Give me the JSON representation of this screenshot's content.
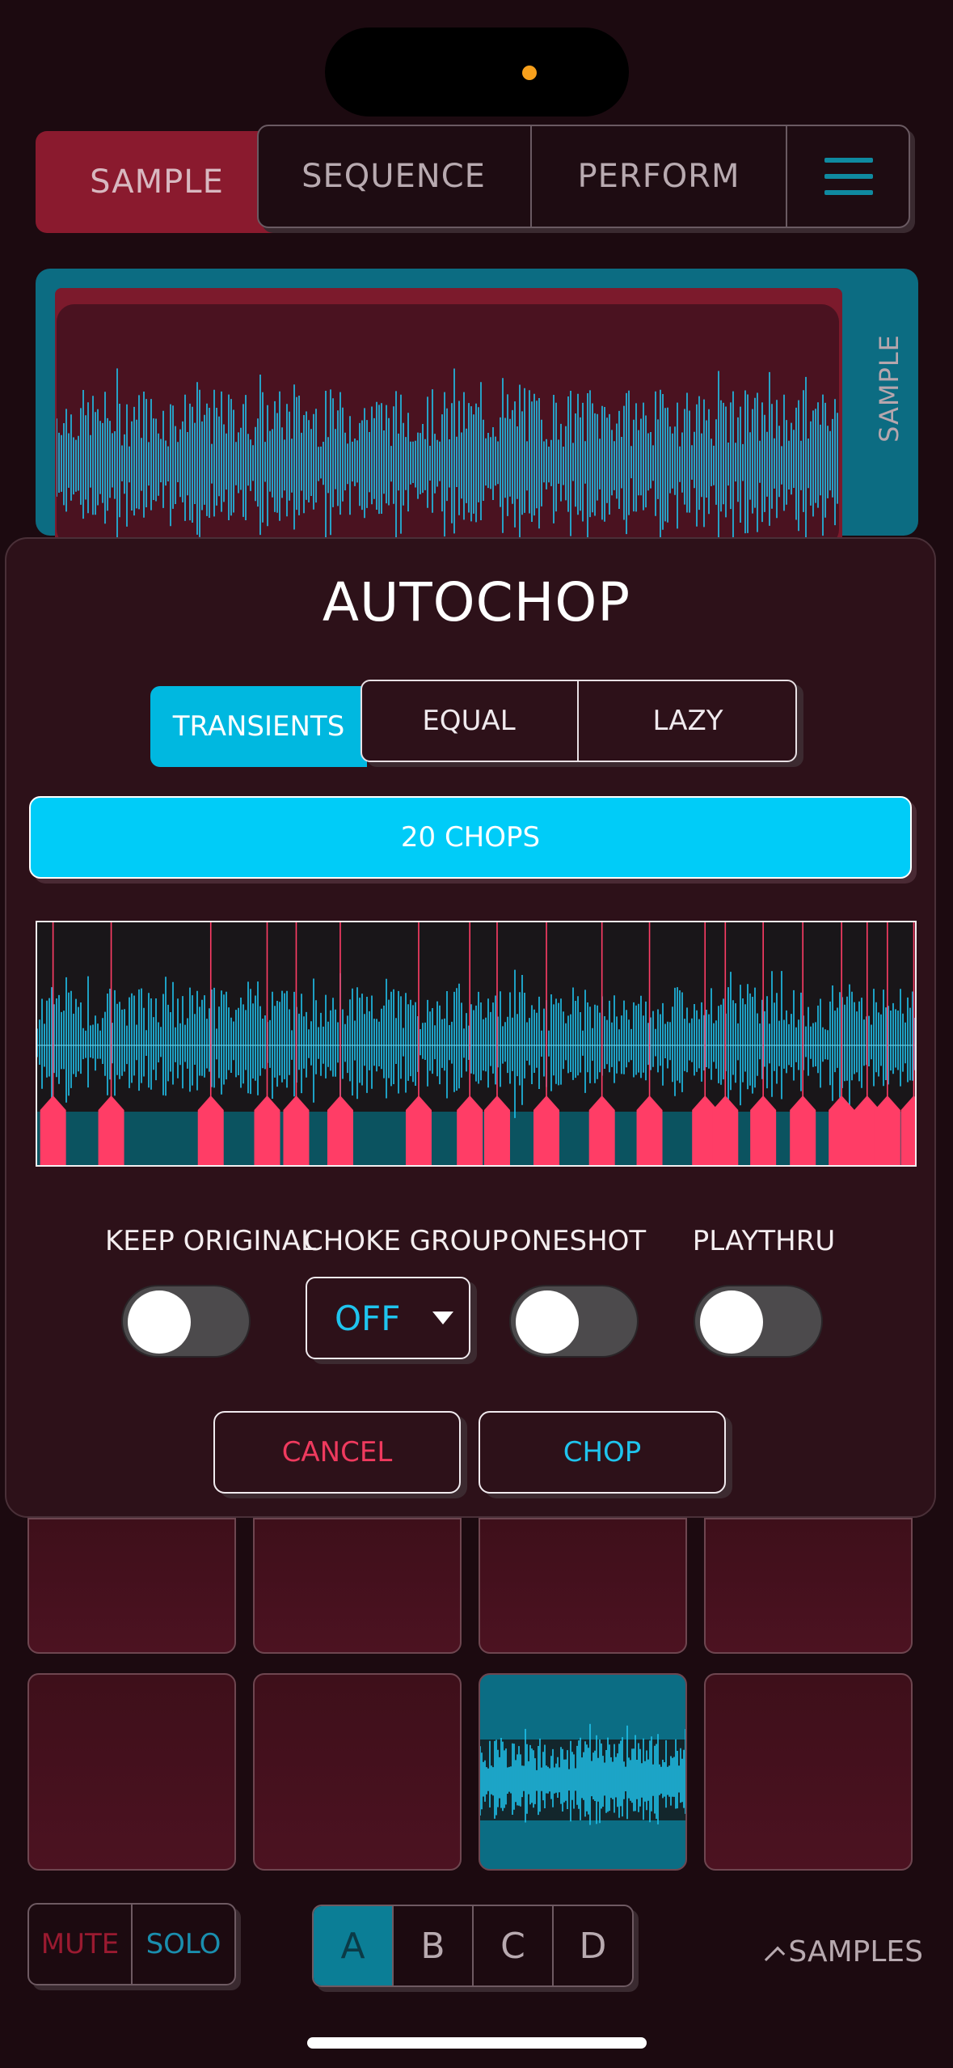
{
  "colors": {
    "accent_cyan": "#00ccf8",
    "waveform": "#1fc4ee",
    "chop_marker": "#ff3d66",
    "cancel_text": "#ef3a5e",
    "background": "#1c0a10",
    "modal_bg": "#2d1119"
  },
  "top_tabs": {
    "sample": "SAMPLE",
    "sequence": "SEQUENCE",
    "perform": "PERFORM",
    "menu_icon": "hamburger-menu-icon"
  },
  "sample_panel": {
    "label": "SAMPLE"
  },
  "autochop": {
    "title": "AUTOCHOP",
    "modes": {
      "transients": "TRANSIENTS",
      "equal": "EQUAL",
      "lazy": "LAZY",
      "selected": "TRANSIENTS"
    },
    "chops_label": "20 CHOPS",
    "chop_count": 20,
    "chop_markers_fraction": [
      0.018,
      0.084,
      0.197,
      0.261,
      0.294,
      0.344,
      0.433,
      0.491,
      0.522,
      0.578,
      0.641,
      0.695,
      0.758,
      0.781,
      0.824,
      0.869,
      0.913,
      0.942,
      0.965,
      0.995
    ],
    "options": {
      "keep_original": {
        "label": "KEEP ORIGINAL",
        "on": false
      },
      "choke_group": {
        "label": "CHOKE GROUP",
        "value": "OFF"
      },
      "oneshot": {
        "label": "ONESHOT",
        "on": false
      },
      "playthru": {
        "label": "PLAYTHRU",
        "on": false
      }
    },
    "cancel_label": "CANCEL",
    "chop_label": "CHOP"
  },
  "pads": {
    "count": 8,
    "loaded_pad_index": 7
  },
  "bottom_bar": {
    "mute": "MUTE",
    "solo": "SOLO",
    "banks": [
      "A",
      "B",
      "C",
      "D"
    ],
    "active_bank": "A",
    "samples_label": "SAMPLES",
    "samples_icon": "chevron-up-icon"
  }
}
